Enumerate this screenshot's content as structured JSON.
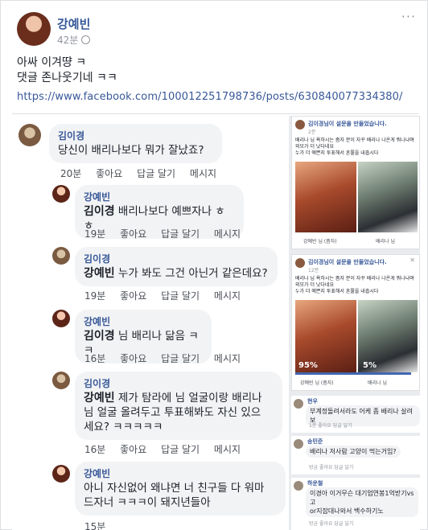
{
  "post": {
    "author": "강예빈",
    "time": "42분",
    "more": "···",
    "text_line1": "아싸 이겨땽 ㅋ",
    "text_line2": "댓글 존나웃기네 ㅋㅋ",
    "link": "https://www.facebook.com/100012251798736/posts/630840077334380/"
  },
  "comments": [
    {
      "author": "김이경",
      "tag": "",
      "text": "당신이 배리나보다 뭐가 잘났죠?",
      "time": "20분"
    },
    {
      "author": "강예빈",
      "tag": "김이경",
      "text": " 배리나보다 예쁘자나 ㅎㅎ",
      "time": "19분"
    },
    {
      "author": "김이경",
      "tag": "강예빈",
      "text": " 누가 봐도 그건 아닌거 같은데요?",
      "time": "19분"
    },
    {
      "author": "강예빈",
      "tag": "김이경",
      "text": " 님 배리나 닮음 ㅋㅋ",
      "time": "16분"
    },
    {
      "author": "김이경",
      "tag": "강예빈",
      "text_line1": " 제가 탐라에 님 얼굴이랑 배리나",
      "text_line2": "님 얼굴 올려두고 투표해봐도 자신 있으",
      "text_line3": "세요? ㅋㅋㅋㅋㅋ",
      "time": "16분"
    },
    {
      "author": "강예빈",
      "text_line1": "아니 자신없어 왜냐면 너 친구들 다 워마",
      "text_line2": "드자너 ㅋㅋㅋ이 돼지년들아",
      "time": "15분"
    }
  ],
  "actions": {
    "like": "좋아요",
    "reply": "답글 달기",
    "message": "메시지"
  },
  "poll_cards": [
    {
      "header": "김이경님이 설문을 만들었습니다.",
      "time": "2분",
      "text_line1": "배리나 님 욕하시는 좀자 분이 자꾸 배리나 나온게 뭐나냐며",
      "text_line2": "외모가 더 낫다네요",
      "text_line3": "누가 더 예쁜지 투표해서 혼쭐을 내줍시다",
      "left_label": "강예빈 님 (좀자)",
      "right_label": "배리나 님"
    },
    {
      "header": "김이경님이 설문을 만들었습니다.",
      "time": "12분",
      "text_line1": "배리나 님 욕하시는 좀자 분이 자꾸 배리나 나온게 뭐나냐며",
      "text_line2": "외모가 더 낫다네요",
      "text_line3": "누가 더 예쁜지 투표해서 혼쭐을 내줍시다",
      "left_label": "강예빈 님 (좀자)",
      "right_label": "배리나 님",
      "left_pct": "95%",
      "right_pct": "5%",
      "left_fraction": 0.95,
      "right_fraction": 0.05
    }
  ],
  "side_comments": [
    {
      "author": "현우",
      "text": "부계정돌려서라도 어케 좀 배리나 살려보",
      "meta": "1분  좋아요  답글 달기"
    },
    {
      "author": "송민준",
      "text": "배리나 저사람 고양이 먹는거임?",
      "meta": "방금  좋아요  답글 달기"
    },
    {
      "author": "하운철",
      "text_line1": "이경아 이거무슨 대기업연봉1억받기vs고",
      "text_line2": "or지잡대나와서 백수하기노",
      "meta": "방금  좋아요  답글 달기"
    }
  ]
}
